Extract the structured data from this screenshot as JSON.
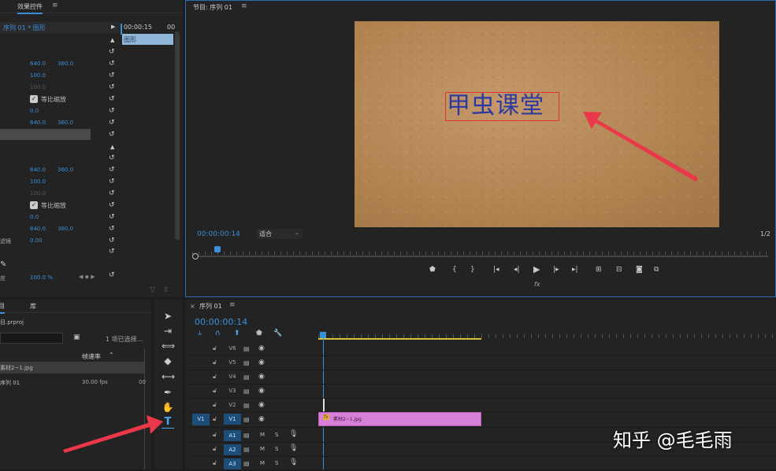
{
  "effect_controls": {
    "tab_label": "效果控件",
    "menu_glyph": "≡",
    "clip_title": "序列 01 * 图形",
    "timecode_top": "00:00:15",
    "timecode_top2": "00",
    "clip_bar_label": "图形",
    "rows": [
      {
        "v1": "640.0",
        "v2": "360.0"
      },
      {
        "v1": "100.0"
      },
      {
        "v1": "100.0"
      },
      {
        "check": "等比缩放"
      },
      {
        "v1": "0.0"
      },
      {
        "v1": "640.0",
        "v2": "360.0"
      }
    ],
    "rows2": [
      {
        "v1": "640.0",
        "v2": "360.0"
      },
      {
        "v1": "100.0"
      },
      {
        "v1": "100.0"
      },
      {
        "check": "等比缩放"
      },
      {
        "v1": "0.0"
      },
      {
        "v1": "640.0",
        "v2": "360.0"
      },
      {
        "label": "滤镜",
        "v1": "0.00"
      }
    ],
    "opacity_value": "100.0 %",
    "opacity_label": "度"
  },
  "program_monitor": {
    "tab_label": "节目: 序列 01",
    "menu_glyph": "≡",
    "title_text": "甲虫课堂",
    "timecode": "00:00:00:14",
    "fit_label": "适合",
    "resolution": "1/2",
    "fx_label": "fx"
  },
  "project_panel": {
    "tab_label": "项目",
    "tab_library": "库",
    "file_name": "目.prproj",
    "selection_info": "1 项已选择...",
    "col_framerate": "帧速率",
    "items": [
      {
        "name": "素材2~1.jpg",
        "fps": ""
      },
      {
        "name": "序列 01",
        "fps": "30.00 fps",
        "extra": "00"
      }
    ]
  },
  "timeline": {
    "tab_label": "序列 01",
    "menu_glyph": "≡",
    "close_glyph": "×",
    "timecode": "00:00:00:14",
    "video_tracks": [
      "V6",
      "V5",
      "V4",
      "V3",
      "V2",
      "V1"
    ],
    "source_v1": "V1",
    "audio_tracks": [
      "A1",
      "A2",
      "A3"
    ],
    "clip_label": "素材2~1.jpg",
    "m_label": "M",
    "s_label": "S"
  },
  "watermark": {
    "text": "知乎 @毛毛雨"
  },
  "colors": {
    "accent_blue": "#3a8fd9",
    "clip_pink": "#d87fd8",
    "text_box_border": "#e03030",
    "title_text": "#2a3aa0",
    "arrow_red": "#e8384a"
  }
}
